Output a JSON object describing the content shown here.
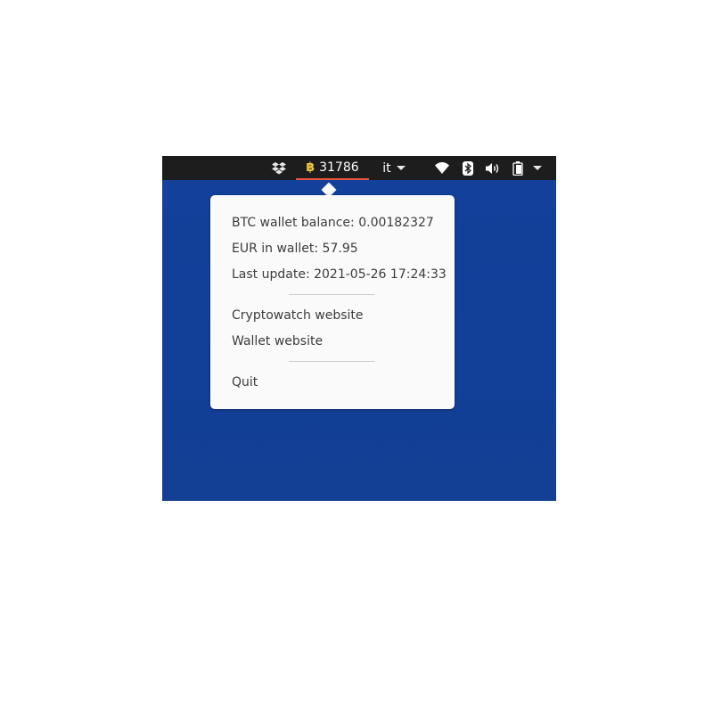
{
  "topbar": {
    "btc_symbol": "฿",
    "btc_price": "31786",
    "language": "it",
    "icons": [
      "dropbox-icon",
      "wifi-icon",
      "bluetooth-icon",
      "volume-icon",
      "battery-icon",
      "chevron-down-icon"
    ]
  },
  "menu": {
    "btc_balance": "BTC wallet balance: 0.00182327",
    "eur_wallet": "EUR in wallet: 57.95",
    "last_update": "Last update: 2021-05-26 17:24:33",
    "cryptowatch": "Cryptowatch website",
    "wallet": "Wallet website",
    "quit": "Quit"
  },
  "colors": {
    "topbar": "#1d1d1d",
    "desktop": "#12409a",
    "active_underline": "#e9553a",
    "btc_symbol": "#f2c744",
    "popup_bg": "#fafafa"
  }
}
